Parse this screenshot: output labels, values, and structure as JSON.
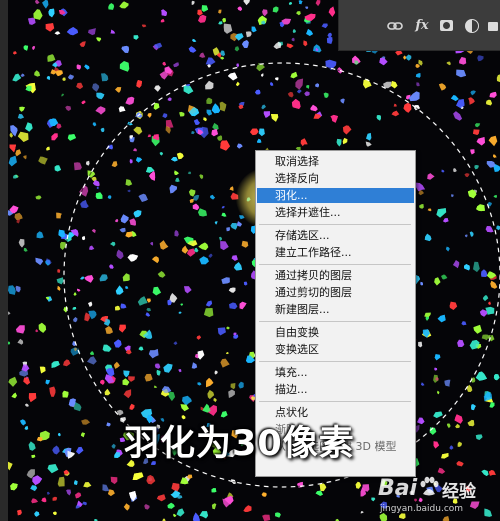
{
  "toolbar": {
    "icons": [
      "link-icon",
      "fx-icon",
      "layer-mask-icon",
      "adjustment-layer-icon",
      "new-group-icon"
    ],
    "fx_label": "fx"
  },
  "context_menu": {
    "items": [
      {
        "label": "取消选择",
        "state": "normal"
      },
      {
        "label": "选择反向",
        "state": "normal"
      },
      {
        "label": "羽化...",
        "state": "highlighted"
      },
      {
        "label": "选择并遮住...",
        "state": "normal"
      },
      {
        "label": "存储选区...",
        "state": "normal"
      },
      {
        "label": "建立工作路径...",
        "state": "normal"
      },
      {
        "label": "通过拷贝的图层",
        "state": "normal"
      },
      {
        "label": "通过剪切的图层",
        "state": "normal"
      },
      {
        "label": "新建图层...",
        "state": "normal"
      },
      {
        "label": "自由变换",
        "state": "normal"
      },
      {
        "label": "变换选区",
        "state": "normal"
      },
      {
        "label": "填充...",
        "state": "normal"
      },
      {
        "label": "描边...",
        "state": "normal"
      },
      {
        "label": "点状化",
        "state": "normal"
      },
      {
        "label": "渐隐...",
        "state": "faded"
      },
      {
        "label": "从当前选区新建 3D 模型",
        "state": "faded"
      }
    ]
  },
  "caption": "羽化为30像素",
  "watermark": {
    "logo": "Bai",
    "site_name": "经验",
    "domain": "jingyan.baidu.com"
  },
  "colors": {
    "menu_background": "#f2f2f2",
    "menu_highlight": "#2f7fd6",
    "panel_background": "#3c3c3c",
    "canvas_background": "#050508"
  }
}
